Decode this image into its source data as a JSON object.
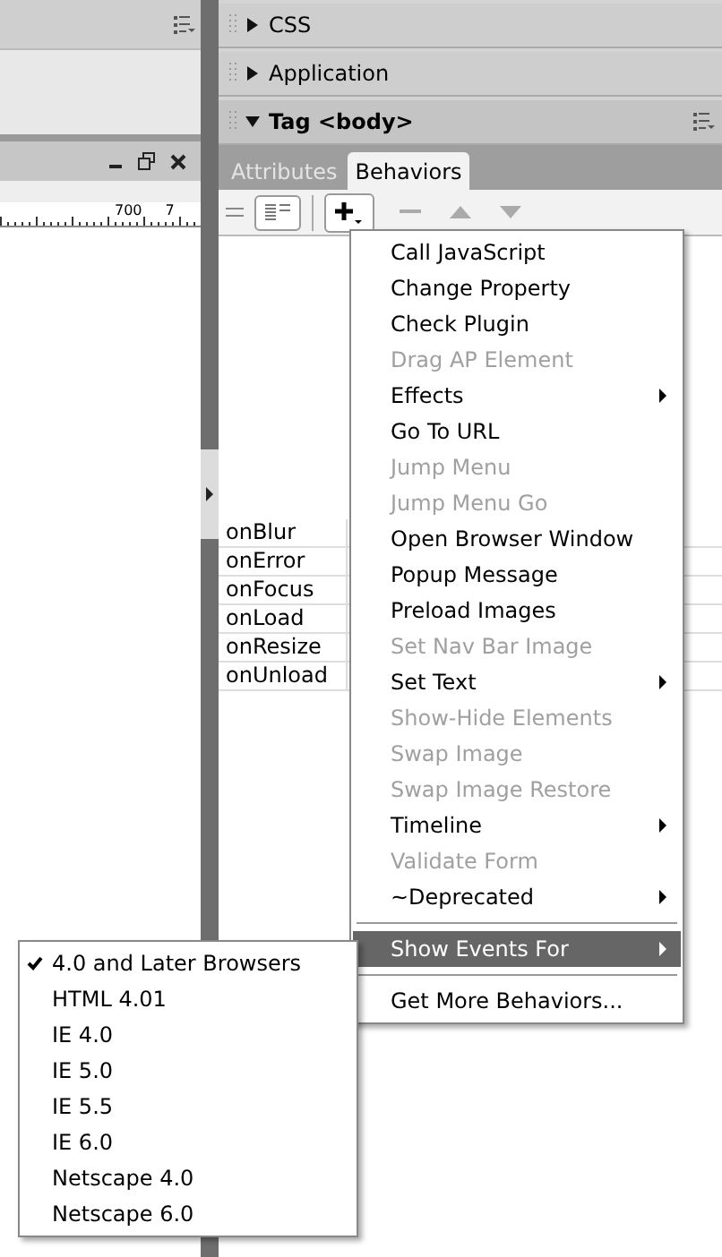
{
  "document": {
    "ruler_labels": [
      "700",
      "7"
    ]
  },
  "panels": [
    {
      "title": "CSS",
      "expanded": false
    },
    {
      "title": "Application",
      "expanded": false
    },
    {
      "title": "Tag <body>",
      "expanded": true
    }
  ],
  "tabs": [
    {
      "label": "Attributes",
      "selected": false
    },
    {
      "label": "Behaviors",
      "selected": true
    }
  ],
  "events": [
    "onBlur",
    "onError",
    "onFocus",
    "onLoad",
    "onResize",
    "onUnload"
  ],
  "menu": [
    {
      "label": "Call JavaScript",
      "disabled": false,
      "submenu": false,
      "selected": false
    },
    {
      "label": "Change Property",
      "disabled": false,
      "submenu": false,
      "selected": false
    },
    {
      "label": "Check Plugin",
      "disabled": false,
      "submenu": false,
      "selected": false
    },
    {
      "label": "Drag AP Element",
      "disabled": true,
      "submenu": false,
      "selected": false
    },
    {
      "label": "Effects",
      "disabled": false,
      "submenu": true,
      "selected": false
    },
    {
      "label": "Go To URL",
      "disabled": false,
      "submenu": false,
      "selected": false
    },
    {
      "label": "Jump Menu",
      "disabled": true,
      "submenu": false,
      "selected": false
    },
    {
      "label": "Jump Menu Go",
      "disabled": true,
      "submenu": false,
      "selected": false
    },
    {
      "label": "Open Browser Window",
      "disabled": false,
      "submenu": false,
      "selected": false
    },
    {
      "label": "Popup Message",
      "disabled": false,
      "submenu": false,
      "selected": false
    },
    {
      "label": "Preload Images",
      "disabled": false,
      "submenu": false,
      "selected": false
    },
    {
      "label": "Set Nav Bar Image",
      "disabled": true,
      "submenu": false,
      "selected": false
    },
    {
      "label": "Set Text",
      "disabled": false,
      "submenu": true,
      "selected": false
    },
    {
      "label": "Show-Hide Elements",
      "disabled": true,
      "submenu": false,
      "selected": false
    },
    {
      "label": "Swap Image",
      "disabled": true,
      "submenu": false,
      "selected": false
    },
    {
      "label": "Swap Image Restore",
      "disabled": true,
      "submenu": false,
      "selected": false
    },
    {
      "label": "Timeline",
      "disabled": false,
      "submenu": true,
      "selected": false
    },
    {
      "label": "Validate Form",
      "disabled": true,
      "submenu": false,
      "selected": false
    },
    {
      "label": "~Deprecated",
      "disabled": false,
      "submenu": true,
      "selected": false
    },
    {
      "kind": "separator"
    },
    {
      "label": "Show Events For",
      "disabled": false,
      "submenu": true,
      "selected": true
    },
    {
      "kind": "separator"
    },
    {
      "label": "Get More Behaviors...",
      "disabled": false,
      "submenu": false,
      "selected": false
    }
  ],
  "submenu": [
    {
      "label": "4.0 and Later Browsers",
      "checked": true
    },
    {
      "label": "HTML 4.01",
      "checked": false
    },
    {
      "label": "IE 4.0",
      "checked": false
    },
    {
      "label": "IE 5.0",
      "checked": false
    },
    {
      "label": "IE 5.5",
      "checked": false
    },
    {
      "label": "IE 6.0",
      "checked": false
    },
    {
      "label": "Netscape 4.0",
      "checked": false
    },
    {
      "label": "Netscape 6.0",
      "checked": false
    }
  ]
}
